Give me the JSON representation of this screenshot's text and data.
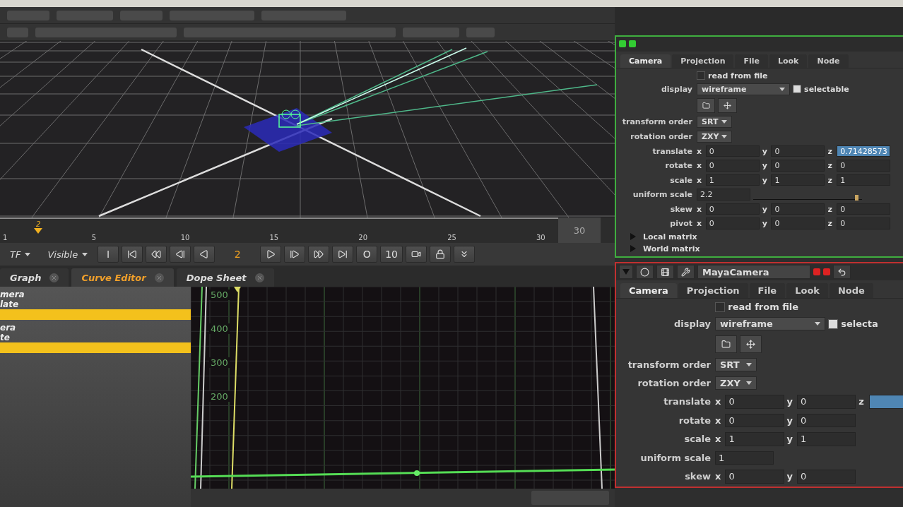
{
  "viewer": {
    "ruler_labels": [
      "1",
      "5",
      "10",
      "15",
      "20",
      "25",
      "30"
    ],
    "playhead": {
      "label": "2",
      "level": 0.036
    },
    "frame_end": "30"
  },
  "transport": {
    "mode": "TF",
    "visibility": "Visible",
    "in_button": "I",
    "current_frame": "2",
    "out_button": "O",
    "step": "10"
  },
  "panel_tabs": [
    {
      "label": "Graph",
      "selected": false
    },
    {
      "label": "Curve Editor",
      "selected": true
    },
    {
      "label": "Dope Sheet",
      "selected": false
    }
  ],
  "curve_list": [
    {
      "kind": "name",
      "label": "mera"
    },
    {
      "kind": "name",
      "label": "late"
    },
    {
      "kind": "bar"
    },
    {
      "kind": "name",
      "label": "era"
    },
    {
      "kind": "name",
      "label": "te"
    },
    {
      "kind": "bar"
    }
  ],
  "curve_editor": {
    "axis_labels": [
      "500",
      "400",
      "300",
      "200"
    ]
  },
  "properties_top": {
    "tabs": [
      {
        "label": "Camera",
        "selected": true
      },
      {
        "label": "Projection",
        "selected": false
      },
      {
        "label": "File",
        "selected": false
      },
      {
        "label": "Look",
        "selected": false
      },
      {
        "label": "Node",
        "selected": false
      }
    ],
    "read_from_file": {
      "label": "read from file",
      "checked": false
    },
    "display": {
      "label": "display",
      "value": "wireframe"
    },
    "selectable": {
      "label": "selectable",
      "checked": true
    },
    "rows": [
      {
        "kind": "menu",
        "label": "transform order",
        "value": "SRT"
      },
      {
        "kind": "menu",
        "label": "rotation order",
        "value": "ZXY"
      },
      {
        "kind": "xyz",
        "label": "translate",
        "fields": [
          {
            "axis": "x",
            "value": "0",
            "selected": false
          },
          {
            "axis": "y",
            "value": "0",
            "selected": false
          },
          {
            "axis": "z",
            "value": "0.71428573",
            "selected": true
          }
        ]
      },
      {
        "kind": "xyz",
        "label": "rotate",
        "fields": [
          {
            "axis": "x",
            "value": "0",
            "selected": false
          },
          {
            "axis": "y",
            "value": "0",
            "selected": false
          },
          {
            "axis": "z",
            "value": "0",
            "selected": false
          }
        ]
      },
      {
        "kind": "xyz",
        "label": "scale",
        "fields": [
          {
            "axis": "x",
            "value": "1",
            "selected": false
          },
          {
            "axis": "y",
            "value": "1",
            "selected": false
          },
          {
            "axis": "z",
            "value": "1",
            "selected": false
          }
        ]
      },
      {
        "kind": "slider",
        "label": "uniform scale",
        "value": "2.2",
        "level": 0.95
      },
      {
        "kind": "xyz",
        "label": "skew",
        "fields": [
          {
            "axis": "x",
            "value": "0",
            "selected": false
          },
          {
            "axis": "y",
            "value": "0",
            "selected": false
          },
          {
            "axis": "z",
            "value": "0",
            "selected": false
          }
        ]
      },
      {
        "kind": "xyz",
        "label": "pivot",
        "fields": [
          {
            "axis": "x",
            "value": "0",
            "selected": false
          },
          {
            "axis": "y",
            "value": "0",
            "selected": false
          },
          {
            "axis": "z",
            "value": "0",
            "selected": false
          }
        ]
      }
    ],
    "groups": [
      {
        "label": "Local matrix",
        "expanded": false
      },
      {
        "label": "World matrix",
        "expanded": false
      }
    ]
  },
  "properties_bottom": {
    "node_name": "MayaCamera",
    "tabs": [
      {
        "label": "Camera",
        "selected": true
      },
      {
        "label": "Projection",
        "selected": false
      },
      {
        "label": "File",
        "selected": false
      },
      {
        "label": "Look",
        "selected": false
      },
      {
        "label": "Node",
        "selected": false
      }
    ],
    "read_from_file": {
      "label": "read from file",
      "checked": false
    },
    "display": {
      "label": "display",
      "value": "wireframe"
    },
    "selectable": {
      "label": "selecta",
      "checked": true
    },
    "rows": [
      {
        "kind": "menu",
        "label": "transform order",
        "value": "SRT"
      },
      {
        "kind": "menu",
        "label": "rotation order",
        "value": "ZXY"
      },
      {
        "kind": "xyz",
        "label": "translate",
        "fields": [
          {
            "axis": "x",
            "value": "0",
            "selected": false
          },
          {
            "axis": "y",
            "value": "0",
            "selected": false
          },
          {
            "axis": "z",
            "selected": true
          }
        ]
      },
      {
        "kind": "xyz",
        "label": "rotate",
        "fields": [
          {
            "axis": "x",
            "value": "0",
            "selected": false
          },
          {
            "axis": "y",
            "value": "0",
            "selected": false
          }
        ]
      },
      {
        "kind": "xyz",
        "label": "scale",
        "fields": [
          {
            "axis": "x",
            "value": "1",
            "selected": false
          },
          {
            "axis": "y",
            "value": "1",
            "selected": false
          }
        ]
      },
      {
        "kind": "slider",
        "label": "uniform scale",
        "value": "1"
      },
      {
        "kind": "xyz",
        "label": "skew",
        "fields": [
          {
            "axis": "x",
            "value": "0",
            "selected": false
          },
          {
            "axis": "y",
            "value": "0",
            "selected": false
          }
        ]
      }
    ]
  }
}
